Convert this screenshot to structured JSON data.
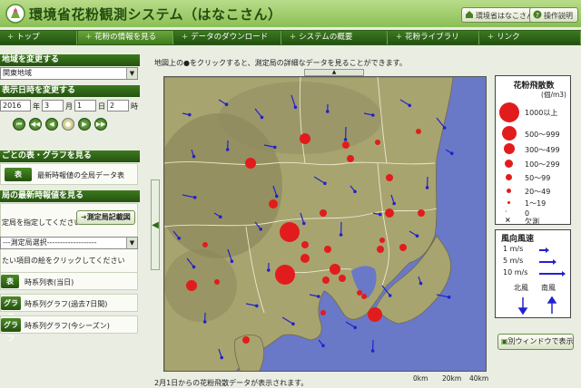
{
  "header": {
    "title": "環境省花粉観測システム（はなこさん）",
    "about_label": "環境省はなこさん",
    "help_label": "操作説明"
  },
  "nav": {
    "tabs": [
      {
        "label": "トップ"
      },
      {
        "label": "花粉の情報を見る"
      },
      {
        "label": "データのダウンロード"
      },
      {
        "label": "システムの概要"
      },
      {
        "label": "花粉ライブラリ"
      },
      {
        "label": "リンク"
      }
    ]
  },
  "sidebar": {
    "region_heading": "地域を変更する",
    "region_value": "関東地域",
    "datetime_heading": "表示日時を変更する",
    "year": "2016",
    "year_suffix": "年",
    "month": "3",
    "month_suffix": "月",
    "day": "1",
    "day_suffix": "日",
    "hour": "2",
    "hour_suffix": "時",
    "table_heading": "ごとの表・グラフを見る",
    "table_button": "表",
    "table_link": "最新時報値の全局データ表",
    "station_heading": "局の最新時報値を見る",
    "station_hint": "定局を指定してください",
    "station_map_button": "測定局記載図",
    "station_select": "---測定局選択-------------------",
    "item_hint": "たい項目の絵をクリックしてください",
    "items": [
      {
        "button": "表",
        "label": "時系列表(当日)"
      },
      {
        "button": "グラフ",
        "label": "時系列グラフ(過去7日間)"
      },
      {
        "button": "グラフ",
        "label": "時系列グラフ(今シーズン)"
      }
    ]
  },
  "main": {
    "note": "地図上の●をクリックすると、測定局の詳細なデータを見ることができます。",
    "footnote": "2月1日からの花粉飛散データが表示されます。"
  },
  "legend": {
    "title": "花粉飛散数",
    "unit": "(個/m3)",
    "rows": [
      {
        "label": "1000以上",
        "size": 22
      },
      {
        "label": "500～999",
        "size": 16
      },
      {
        "label": "300～499",
        "size": 12
      },
      {
        "label": "100～299",
        "size": 9
      },
      {
        "label": "50～99",
        "size": 7
      },
      {
        "label": "20～49",
        "size": 5
      },
      {
        "label": "1～19",
        "size": 3
      },
      {
        "label": "0",
        "size": 0
      },
      {
        "label": "欠測",
        "size": 0
      }
    ]
  },
  "wind_legend": {
    "title": "風向風速",
    "rows": [
      {
        "label": "1 m/s"
      },
      {
        "label": "5 m/s"
      },
      {
        "label": "10 m/s"
      }
    ],
    "north_wind": "北風",
    "south_wind": "南風"
  },
  "open_window_label": "別ウィンドウで表示",
  "scale": {
    "labels": [
      "0km",
      "20km",
      "40km"
    ]
  },
  "colors": {
    "accent": "#2f5f1a",
    "marker": "#e21c1c",
    "wind_arrow": "#2222cc",
    "sea": "#6a78c8"
  }
}
